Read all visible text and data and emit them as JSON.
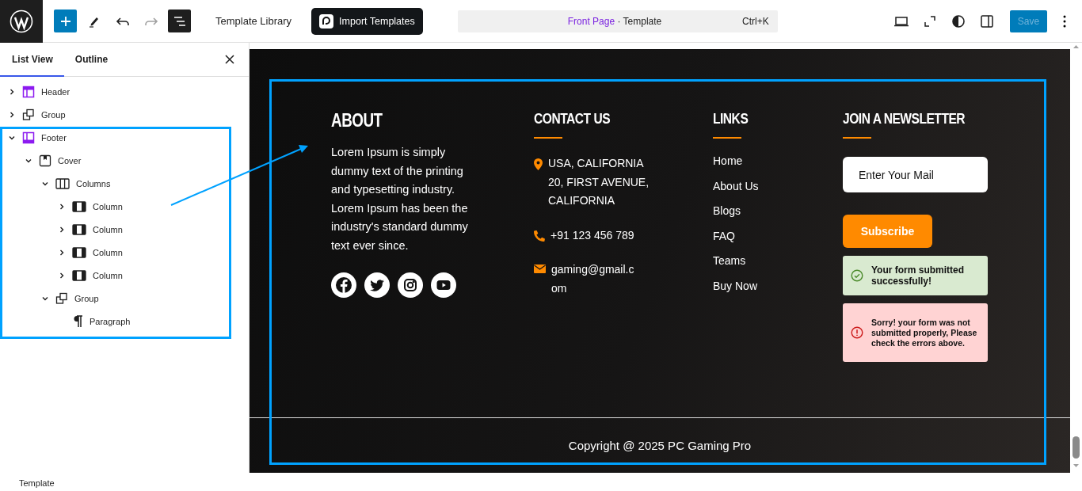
{
  "toolbar": {
    "tools": [
      {
        "kind": "add",
        "selected": false,
        "disabled": false
      },
      {
        "kind": "pen",
        "selected": false,
        "disabled": false
      },
      {
        "kind": "undo",
        "selected": false,
        "disabled": false
      },
      {
        "kind": "redo",
        "selected": false,
        "disabled": true
      },
      {
        "kind": "list",
        "selected": true,
        "disabled": false
      }
    ],
    "template_library": "Template Library",
    "import_templates": "Import Templates",
    "command": {
      "page": "Front Page",
      "separator": "·",
      "type": "Template",
      "shortcut": "Ctrl+K"
    },
    "right_tools": [
      {
        "kind": "desktop"
      },
      {
        "kind": "fullscreen"
      },
      {
        "kind": "contrast"
      },
      {
        "kind": "sidebar"
      }
    ],
    "save": {
      "label": "Save",
      "disabled": true
    }
  },
  "sidebar": {
    "tabs": [
      {
        "label": "List View",
        "selected": true
      },
      {
        "label": "Outline",
        "selected": false
      }
    ],
    "tree": [
      {
        "label": "Header",
        "kind": "header",
        "expanded": false
      },
      {
        "label": "Group",
        "kind": "group",
        "expanded": false
      },
      {
        "label": "Footer",
        "kind": "footer",
        "expanded": true,
        "children": [
          {
            "label": "Cover",
            "kind": "cover",
            "expanded": true,
            "children": [
              {
                "label": "Columns",
                "kind": "columns",
                "expanded": true,
                "children": [
                  {
                    "label": "Column",
                    "kind": "column",
                    "expanded": false
                  },
                  {
                    "label": "Column",
                    "kind": "column",
                    "expanded": false
                  },
                  {
                    "label": "Column",
                    "kind": "column",
                    "expanded": false
                  },
                  {
                    "label": "Column",
                    "kind": "column",
                    "expanded": false
                  }
                ]
              },
              {
                "label": "Group",
                "kind": "group",
                "expanded": true,
                "children": [
                  {
                    "label": "Paragraph",
                    "kind": "paragraph"
                  }
                ]
              }
            ]
          }
        ]
      }
    ]
  },
  "footer": {
    "about": {
      "heading": "ABOUT",
      "text": "Lorem Ipsum is simply dummy text of the printing and typesetting industry. Lorem Ipsum has been the industry's standard dummy text ever since.",
      "social": [
        {
          "kind": "facebook"
        },
        {
          "kind": "twitter"
        },
        {
          "kind": "instagram"
        },
        {
          "kind": "youtube"
        }
      ]
    },
    "contact": {
      "heading": "CONTACT US",
      "items": [
        {
          "kind": "location",
          "text": "USA, CALIFORNIA 20, FIRST AVENUE, CALIFORNIA"
        },
        {
          "kind": "phone",
          "text": "+91 123 456 789"
        },
        {
          "kind": "email",
          "text": "gaming@gmail.com"
        }
      ]
    },
    "links": {
      "heading": "LINKS",
      "items": [
        "Home",
        "About Us",
        "Blogs",
        "FAQ",
        "Teams",
        "Buy Now"
      ]
    },
    "newsletter": {
      "heading": "JOIN A NEWSLETTER",
      "placeholder": "Enter Your Mail",
      "button": "Subscribe",
      "alerts": [
        {
          "kind": "success",
          "text": "Your form submitted successfully!"
        },
        {
          "kind": "error",
          "text": "Sorry! your form was not submitted properly, Please check the errors above."
        }
      ]
    },
    "copyright": "Copyright @ 2025 PC Gaming Pro"
  },
  "status_bar": "Template"
}
